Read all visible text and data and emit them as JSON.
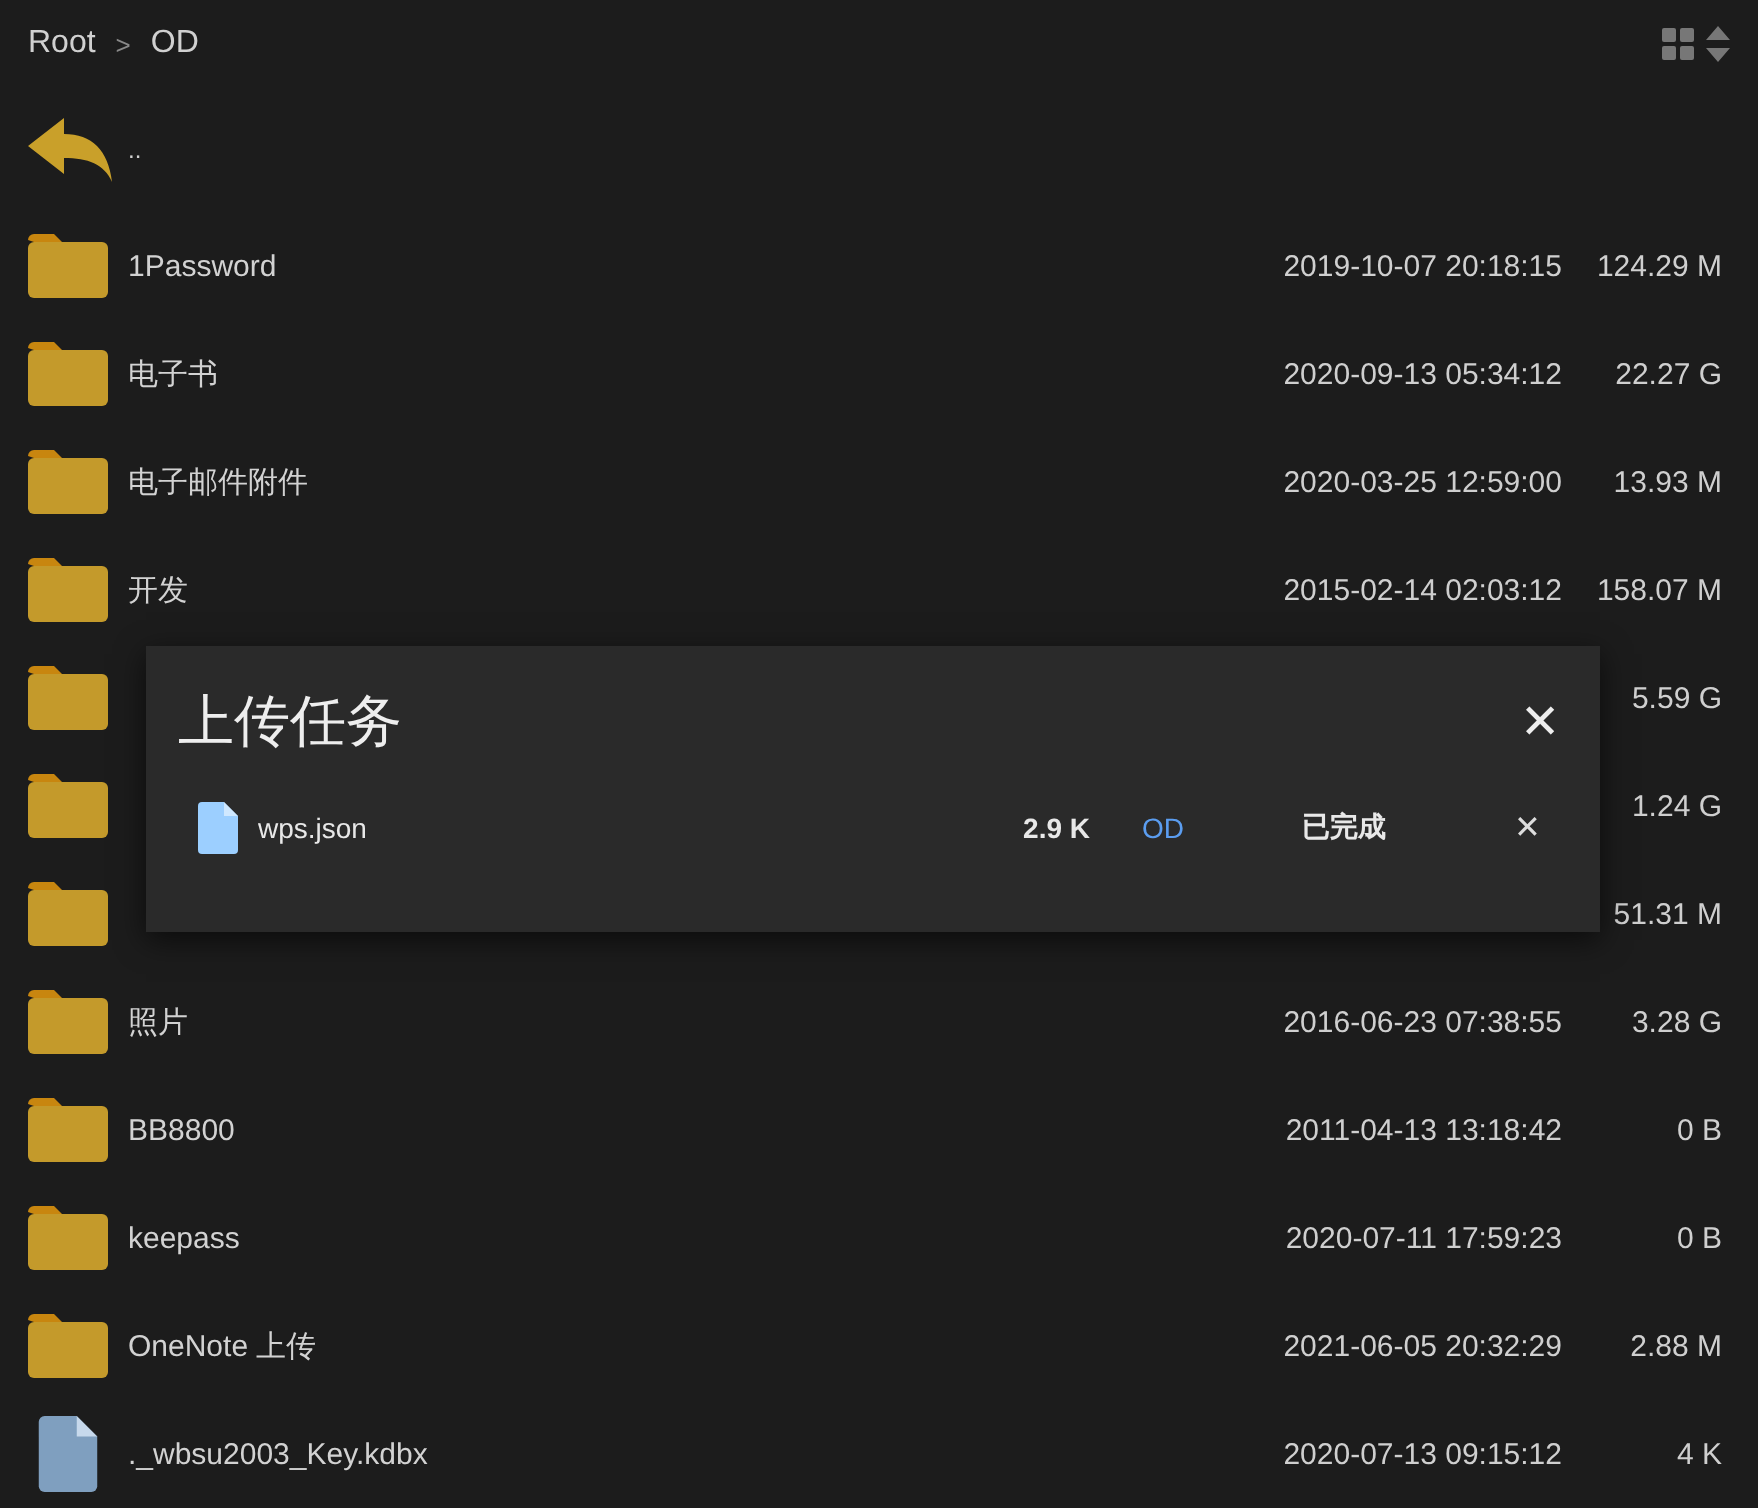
{
  "breadcrumb": [
    "Root",
    "OD"
  ],
  "separator": ">",
  "parent": {
    "label": ".."
  },
  "rows": [
    {
      "kind": "folder",
      "name": "1Password",
      "date": "2019-10-07 20:18:15",
      "size": "124.29 M"
    },
    {
      "kind": "folder",
      "name": "电子书",
      "date": "2020-09-13 05:34:12",
      "size": "22.27 G"
    },
    {
      "kind": "folder",
      "name": "电子邮件附件",
      "date": "2020-03-25 12:59:00",
      "size": "13.93 M"
    },
    {
      "kind": "folder",
      "name": "开发",
      "date": "2015-02-14 02:03:12",
      "size": "158.07 M"
    },
    {
      "kind": "folder",
      "size": "5.59 G"
    },
    {
      "kind": "folder",
      "size": "1.24 G"
    },
    {
      "kind": "folder",
      "size": "51.31 M"
    },
    {
      "kind": "folder",
      "name": "照片",
      "date": "2016-06-23 07:38:55",
      "size": "3.28 G"
    },
    {
      "kind": "folder",
      "name": "BB8800",
      "date": "2011-04-13 13:18:42",
      "size": "0 B"
    },
    {
      "kind": "folder",
      "name": "keepass",
      "date": "2020-07-11 17:59:23",
      "size": "0 B"
    },
    {
      "kind": "folder",
      "name": "OneNote 上传",
      "date": "2021-06-05 20:32:29",
      "size": "2.88 M"
    },
    {
      "kind": "file",
      "name": "._wbsu2003_Key.kdbx",
      "date": "2020-07-13 09:15:12",
      "size": "4 K"
    }
  ],
  "dialog": {
    "title": "上传任务",
    "close": "✕",
    "tasks": [
      {
        "name": "wps.json",
        "size": "2.9 K",
        "target": "OD",
        "status": "已完成",
        "remove": "✕"
      }
    ]
  }
}
